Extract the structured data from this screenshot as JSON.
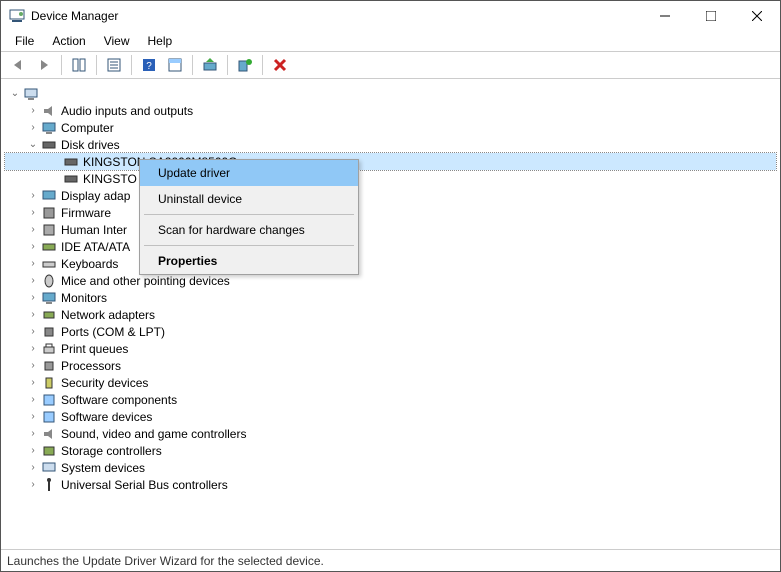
{
  "title": "Device Manager",
  "menubar": [
    "File",
    "Action",
    "View",
    "Help"
  ],
  "toolbar_icons": [
    "back-icon",
    "forward-icon",
    "show-hide-icon",
    "properties-icon",
    "help-icon",
    "details-icon",
    "update-icon",
    "scan-icon",
    "delete-icon"
  ],
  "root": {
    "label": ""
  },
  "tree": {
    "audio": "Audio inputs and outputs",
    "computer": "Computer",
    "disk": "Disk drives",
    "disk_child1": "KINGSTON SA2000M8500G",
    "disk_child2": "KINGSTO",
    "display": "Display adap",
    "firmware": "Firmware",
    "hid": "Human Inter",
    "ide": "IDE ATA/ATA",
    "keyboards": "Keyboards",
    "mice": "Mice and other pointing devices",
    "monitors": "Monitors",
    "network": "Network adapters",
    "ports": "Ports (COM & LPT)",
    "printq": "Print queues",
    "processors": "Processors",
    "security": "Security devices",
    "swcomp": "Software components",
    "swdev": "Software devices",
    "sound": "Sound, video and game controllers",
    "storage": "Storage controllers",
    "system": "System devices",
    "usb": "Universal Serial Bus controllers"
  },
  "context_menu": {
    "update": "Update driver",
    "uninstall": "Uninstall device",
    "scan": "Scan for hardware changes",
    "properties": "Properties"
  },
  "statusbar": "Launches the Update Driver Wizard for the selected device."
}
